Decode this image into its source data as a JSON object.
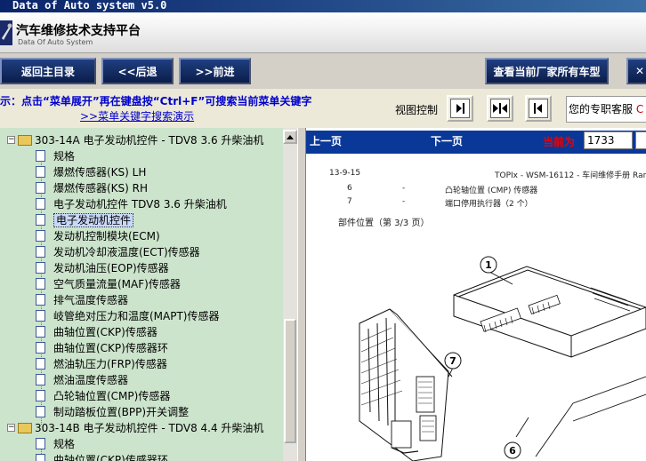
{
  "window": {
    "title": "Data of Auto system v5.0"
  },
  "header": {
    "app_title": "汽车维修技术支持平台",
    "app_subtitle": "Data Of Auto System"
  },
  "toolbar": {
    "home_label": "返回主目录",
    "back_label": "<<后退",
    "forward_label": ">>前进",
    "vendor_models_label": "查看当前厂家所有车型",
    "close_label": "✕"
  },
  "hint": {
    "text": "示：点击“菜单展开”再在键盘按“Ctrl+F”可搜索当前菜单关键字",
    "link": ">>菜单关键字搜索演示"
  },
  "view_control": {
    "label": "视图控制"
  },
  "support": {
    "label": "您的专职客服",
    "tail": "C"
  },
  "tree": {
    "folder1": "303-14A 电子发动机控件 - TDV8 3.6 升柴油机",
    "items": [
      "规格",
      "爆燃传感器(KS) LH",
      "爆燃传感器(KS) RH",
      "电子发动机控件 TDV8 3.6 升柴油机",
      "电子发动机控件",
      "发动机控制模块(ECM)",
      "发动机冷却液温度(ECT)传感器",
      "发动机油压(EOP)传感器",
      "空气质量流量(MAF)传感器",
      "排气温度传感器",
      "岐管绝对压力和温度(MAPT)传感器",
      "曲轴位置(CKP)传感器",
      "曲轴位置(CKP)传感器环",
      "燃油轨压力(FRP)传感器",
      "燃油温度传感器",
      "凸轮轴位置(CMP)传感器",
      "制动踏板位置(BPP)开关调整"
    ],
    "folder2": "303-14B 电子发动机控件 - TDV8 4.4 升柴油机",
    "items2": [
      "规格",
      "曲轴位置(CKP)传感器环"
    ]
  },
  "docnav": {
    "prev": "上一页",
    "next": "下一页",
    "current_label": "当前为",
    "current_value": "1733"
  },
  "document": {
    "header_left": "13-9-15",
    "header_right": "TOPIx - WSM-16112 - 车间维修手册 Range Rover",
    "rows": [
      {
        "num": "6",
        "dash": "-",
        "desc": "凸轮轴位置 (CMP) 传感器"
      },
      {
        "num": "7",
        "dash": "-",
        "desc": "端口停用执行器（2 个）"
      }
    ],
    "section": "部件位置（第 3/3 页）",
    "callouts": [
      "1",
      "7",
      "6"
    ]
  }
}
